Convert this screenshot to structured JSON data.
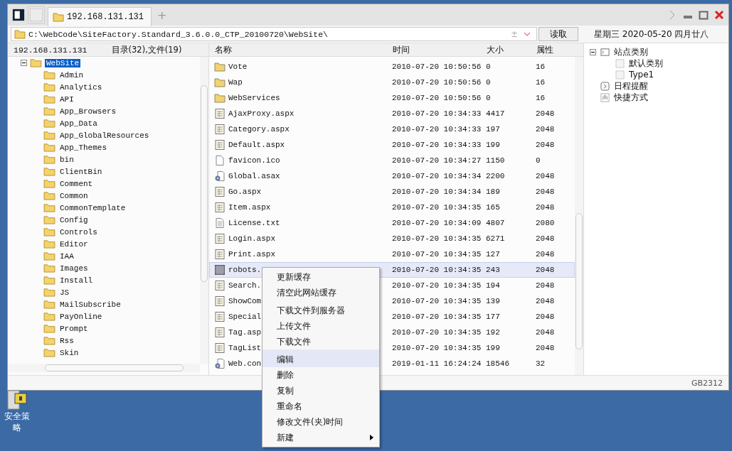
{
  "window": {
    "tabs": [
      {
        "label": "192.168.131.131",
        "selected": true
      }
    ],
    "new_tab": "+"
  },
  "address": {
    "path": "C:\\WebCode\\SiteFactory.Standard_3.6.0.0_CTP_20100720\\WebSite\\",
    "plus_minus": "±",
    "read_button": "读取"
  },
  "date_line": "星期三 2020-05-20 四月廿八",
  "left_pane": {
    "host": "192.168.131.131",
    "counts": "目录(32),文件(19)",
    "tree": [
      {
        "label": "WebSite",
        "selected": true,
        "expanded": true,
        "children": [
          {
            "label": "Admin",
            "selected": false
          },
          {
            "label": "Analytics",
            "selected": false
          },
          {
            "label": "API",
            "selected": false
          },
          {
            "label": "App_Browsers",
            "selected": false
          },
          {
            "label": "App_Data",
            "selected": false
          },
          {
            "label": "App_GlobalResources",
            "selected": false
          },
          {
            "label": "App_Themes",
            "selected": false
          },
          {
            "label": "bin",
            "selected": false
          },
          {
            "label": "ClientBin",
            "selected": false
          },
          {
            "label": "Comment",
            "selected": false
          },
          {
            "label": "Common",
            "selected": false
          },
          {
            "label": "CommonTemplate",
            "selected": false
          },
          {
            "label": "Config",
            "selected": false
          },
          {
            "label": "Controls",
            "selected": false
          },
          {
            "label": "Editor",
            "selected": false
          },
          {
            "label": "IAA",
            "selected": false
          },
          {
            "label": "Images",
            "selected": false
          },
          {
            "label": "Install",
            "selected": false
          },
          {
            "label": "JS",
            "selected": false
          },
          {
            "label": "MailSubscribe",
            "selected": false
          },
          {
            "label": "PayOnline",
            "selected": false
          },
          {
            "label": "Prompt",
            "selected": false
          },
          {
            "label": "Rss",
            "selected": false
          },
          {
            "label": "Skin",
            "selected": false
          }
        ]
      }
    ]
  },
  "file_list": {
    "columns": [
      "名称",
      "时间",
      "大小",
      "属性"
    ],
    "rows": [
      {
        "kind": "folder",
        "name": "Vote",
        "time": "2010-07-20 10:50:56",
        "size": "0",
        "attr": "16",
        "selected": false
      },
      {
        "kind": "folder",
        "name": "Wap",
        "time": "2010-07-20 10:50:56",
        "size": "0",
        "attr": "16",
        "selected": false
      },
      {
        "kind": "folder",
        "name": "WebServices",
        "time": "2010-07-20 10:50:56",
        "size": "0",
        "attr": "16",
        "selected": false
      },
      {
        "kind": "page",
        "name": "AjaxProxy.aspx",
        "time": "2010-07-20 10:34:33",
        "size": "4417",
        "attr": "2048",
        "selected": false
      },
      {
        "kind": "page",
        "name": "Category.aspx",
        "time": "2010-07-20 10:34:33",
        "size": "197",
        "attr": "2048",
        "selected": false
      },
      {
        "kind": "page",
        "name": "Default.aspx",
        "time": "2010-07-20 10:34:33",
        "size": "199",
        "attr": "2048",
        "selected": false
      },
      {
        "kind": "blank",
        "name": "favicon.ico",
        "time": "2010-07-20 10:34:27",
        "size": "1150",
        "attr": "0",
        "selected": false
      },
      {
        "kind": "settings",
        "name": "Global.asax",
        "time": "2010-07-20 10:34:34",
        "size": "2200",
        "attr": "2048",
        "selected": false
      },
      {
        "kind": "page",
        "name": "Go.aspx",
        "time": "2010-07-20 10:34:34",
        "size": "189",
        "attr": "2048",
        "selected": false
      },
      {
        "kind": "page",
        "name": "Item.aspx",
        "time": "2010-07-20 10:34:35",
        "size": "165",
        "attr": "2048",
        "selected": false
      },
      {
        "kind": "text",
        "name": "License.txt",
        "time": "2010-07-20 10:34:09",
        "size": "4807",
        "attr": "2080",
        "selected": false
      },
      {
        "kind": "page",
        "name": "Login.aspx",
        "time": "2010-07-20 10:34:35",
        "size": "6271",
        "attr": "2048",
        "selected": false
      },
      {
        "kind": "page",
        "name": "Print.aspx",
        "time": "2010-07-20 10:34:35",
        "size": "127",
        "attr": "2048",
        "selected": false
      },
      {
        "kind": "grid",
        "name": "robots.",
        "time": "2010-07-20 10:34:35",
        "size": "243",
        "attr": "2048",
        "selected": true
      },
      {
        "kind": "page",
        "name": "Search.",
        "time": "2010-07-20 10:34:35",
        "size": "194",
        "attr": "2048",
        "selected": false
      },
      {
        "kind": "page",
        "name": "ShowCom",
        "time": "2010-07-20 10:34:35",
        "size": "139",
        "attr": "2048",
        "selected": false
      },
      {
        "kind": "page",
        "name": "Special",
        "time": "2010-07-20 10:34:35",
        "size": "177",
        "attr": "2048",
        "selected": false
      },
      {
        "kind": "page",
        "name": "Tag.asp",
        "time": "2010-07-20 10:34:35",
        "size": "192",
        "attr": "2048",
        "selected": false
      },
      {
        "kind": "page",
        "name": "TagList",
        "time": "2010-07-20 10:34:35",
        "size": "199",
        "attr": "2048",
        "selected": false
      },
      {
        "kind": "settings",
        "name": "Web.con",
        "time": "2019-01-11 16:24:24",
        "size": "18546",
        "attr": "32",
        "selected": false
      }
    ]
  },
  "right_pane": {
    "tree": [
      {
        "kind": "category",
        "label": "站点类别",
        "expanded": true,
        "children": [
          {
            "kind": "item",
            "label": "默认类别"
          },
          {
            "kind": "item",
            "label": "Type1"
          }
        ]
      },
      {
        "kind": "schedule",
        "label": "日程提醒"
      },
      {
        "kind": "shortcut",
        "label": "快捷方式"
      }
    ]
  },
  "status_bar": {
    "encoding": "GB2312"
  },
  "context_menu": [
    {
      "label": "更新缓存",
      "gap_before": false,
      "selected": false,
      "submenu": false
    },
    {
      "label": "清空此网站缓存",
      "gap_before": false,
      "selected": false,
      "submenu": false
    },
    {
      "label": "下载文件到服务器",
      "gap_before": true,
      "selected": false,
      "submenu": false
    },
    {
      "label": "上传文件",
      "gap_before": false,
      "selected": false,
      "submenu": false
    },
    {
      "label": "下载文件",
      "gap_before": false,
      "selected": false,
      "submenu": false
    },
    {
      "label": "编辑",
      "gap_before": true,
      "selected": true,
      "submenu": false
    },
    {
      "label": "删除",
      "gap_before": false,
      "selected": false,
      "submenu": false
    },
    {
      "label": "复制",
      "gap_before": false,
      "selected": false,
      "submenu": false
    },
    {
      "label": "重命名",
      "gap_before": false,
      "selected": false,
      "submenu": false
    },
    {
      "label": "修改文件(夹)时间",
      "gap_before": false,
      "selected": false,
      "submenu": false
    },
    {
      "label": "新建",
      "gap_before": false,
      "selected": false,
      "submenu": true
    }
  ],
  "desktop": {
    "icon_label": "安全策略"
  }
}
